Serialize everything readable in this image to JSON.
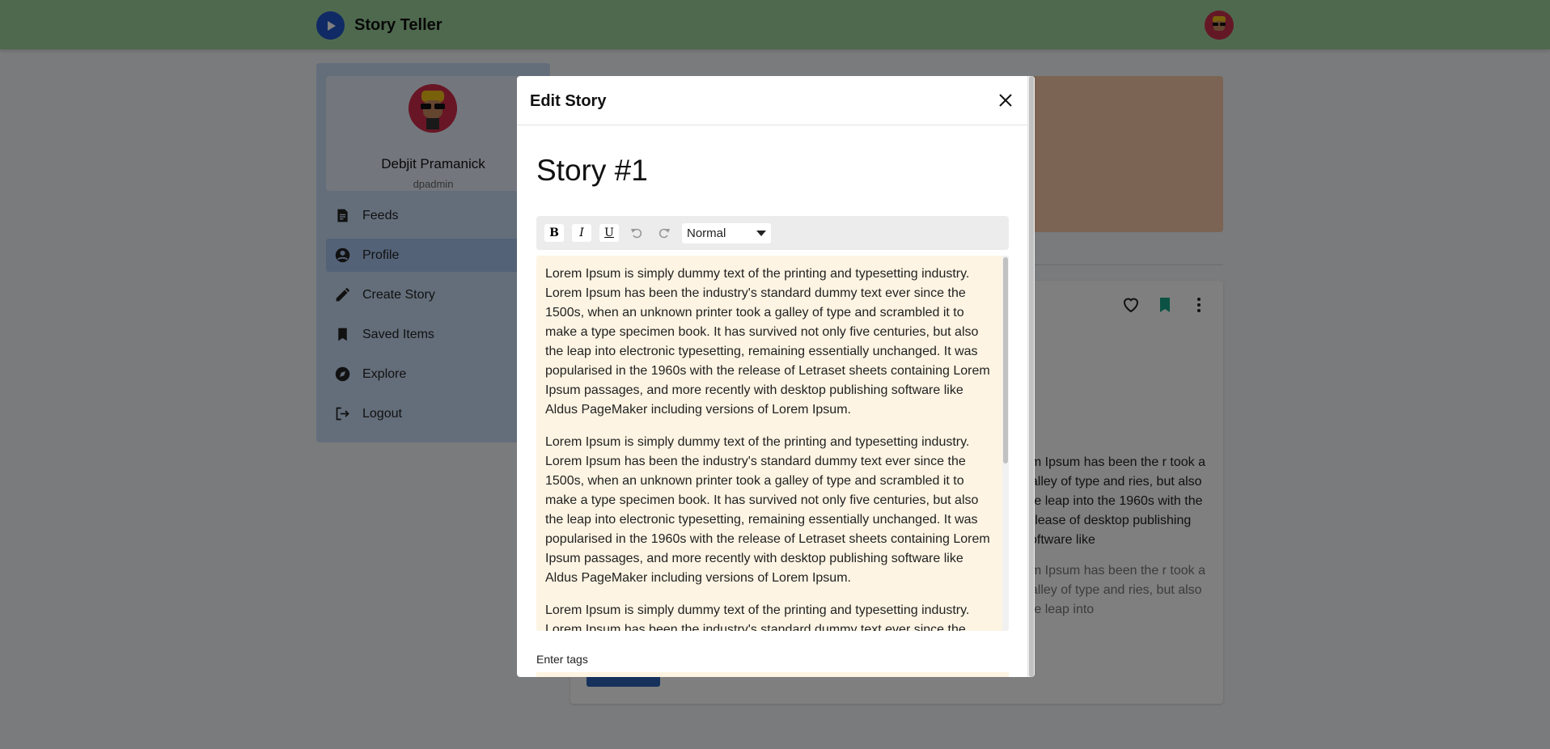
{
  "app": {
    "title": "Story Teller",
    "logo_icon": "play-circle-icon",
    "accent_color": "#1f54c9",
    "topbar_color": "#9fd39f"
  },
  "profile": {
    "name": "Debjit Pramanick",
    "username": "dpadmin"
  },
  "sidebar": {
    "items": [
      {
        "label": "Feeds",
        "icon": "feed-document-icon"
      },
      {
        "label": "Profile",
        "icon": "profile-icon",
        "active": true
      },
      {
        "label": "Create Story",
        "icon": "pencil-icon"
      },
      {
        "label": "Saved Items",
        "icon": "bookmark-icon"
      },
      {
        "label": "Explore",
        "icon": "compass-icon"
      },
      {
        "label": "Logout",
        "icon": "logout-icon"
      }
    ]
  },
  "story_card": {
    "actions": [
      "heart-icon",
      "bookmark-icon",
      "more-vertical-icon"
    ],
    "visible_text": [
      "em Ipsum has been the r took a galley of type and ries, but also the leap into the 1960s with the release of desktop publishing software like",
      "em Ipsum has been the r took a galley of type and ries, but also the leap into"
    ]
  },
  "modal": {
    "title": "Edit Story",
    "close_icon": "close-icon",
    "story_title": "Story #1",
    "toolbar": {
      "bold": "B",
      "italic": "I",
      "underline": "U",
      "undo_icon": "undo-icon",
      "redo_icon": "redo-icon",
      "format_value": "Normal"
    },
    "editor_paragraphs": [
      "Lorem Ipsum is simply dummy text of the printing and typesetting industry. Lorem Ipsum has been the industry's standard dummy text ever since the 1500s, when an unknown printer took a galley of type and scrambled it to make a type specimen book. It has survived not only five centuries, but also the leap into electronic typesetting, remaining essentially unchanged. It was popularised in the 1960s with the release of Letraset sheets containing Lorem Ipsum passages, and more recently with desktop publishing software like Aldus PageMaker including versions of Lorem Ipsum.",
      "Lorem Ipsum is simply dummy text of the printing and typesetting industry. Lorem Ipsum has been the industry's standard dummy text ever since the 1500s, when an unknown printer took a galley of type and scrambled it to make a type specimen book. It has survived not only five centuries, but also the leap into electronic typesetting, remaining essentially unchanged. It was popularised in the 1960s with the release of Letraset sheets containing Lorem Ipsum passages, and more recently with desktop publishing software like Aldus PageMaker including versions of Lorem Ipsum.",
      "Lorem Ipsum is simply dummy text of the printing and typesetting industry. Lorem Ipsum has been the industry's standard dummy text ever since the"
    ],
    "tags_label": "Enter tags"
  }
}
